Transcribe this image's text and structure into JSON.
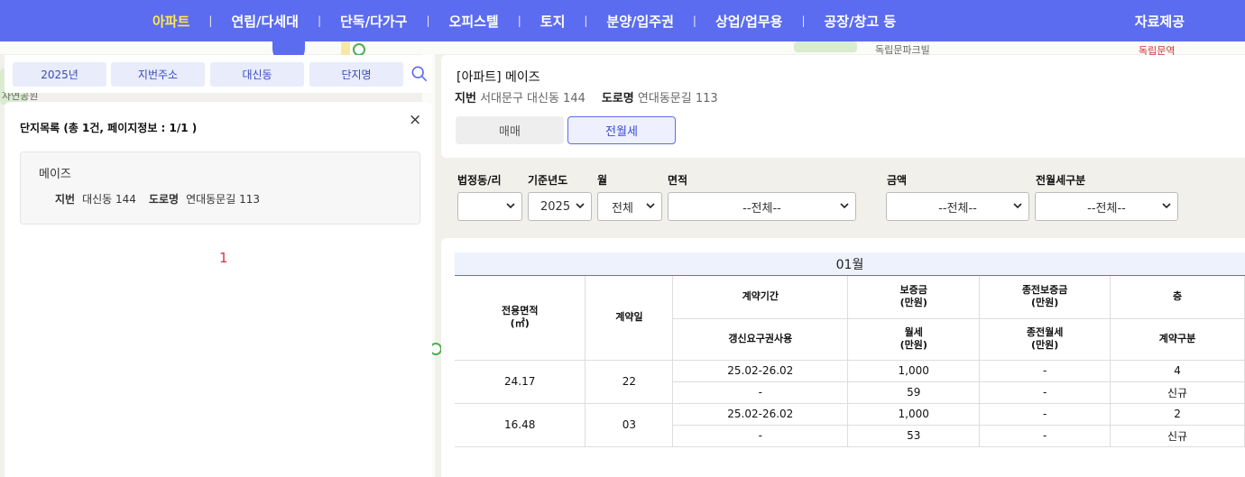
{
  "nav": {
    "items": [
      "아파트",
      "연립/다세대",
      "단독/다가구",
      "오피스텔",
      "토지",
      "분양/입주권",
      "상업/업무용",
      "공장/창고 등"
    ],
    "separator": "|",
    "data_link": "자료제공"
  },
  "map": {
    "labels": [
      "자연공원",
      "독립문파크빌",
      "독립문역"
    ]
  },
  "search": {
    "year": "2025년",
    "address_type": "지번주소",
    "dong": "대신동",
    "complex_name": "단지명"
  },
  "complex_list": {
    "title": "단지목록 (총 1건, 페이지정보 : 1/1 )",
    "close": "×",
    "items": [
      {
        "name": "메이즈",
        "jibun_label": "지번",
        "jibun": "대신동 144",
        "road_label": "도로명",
        "road": "연대동문길 113"
      }
    ],
    "page": "1"
  },
  "detail": {
    "title": "[아파트] 메이즈",
    "jibun_label": "지번",
    "jibun": "서대문구 대신동 144",
    "road_label": "도로명",
    "road": "연대동문길 113",
    "tab_sale": "매매",
    "tab_rent": "전월세",
    "active_tab": "전월세"
  },
  "filters": {
    "dong": {
      "label": "법정동/리",
      "value": ""
    },
    "year": {
      "label": "기준년도",
      "value": "2025"
    },
    "month": {
      "label": "월",
      "value": "전체"
    },
    "area": {
      "label": "면적",
      "value": "--전체--"
    },
    "amount": {
      "label": "금액",
      "value": "--전체--"
    },
    "rent_type": {
      "label": "전월세구분",
      "value": "--전체--"
    }
  },
  "table": {
    "month": "01월",
    "headers": {
      "area": "전용면적\n(㎡)",
      "day": "계약일",
      "period": "계약기간",
      "deposit": "보증금\n(만원)",
      "prev_deposit": "종전보증금\n(만원)",
      "floor": "층",
      "renewal": "갱신요구권사용",
      "monthly": "월세\n(만원)",
      "prev_monthly": "종전월세\n(만원)",
      "contract_type": "계약구분"
    },
    "rows": [
      {
        "area": "24.17",
        "day": "22",
        "period": "25.02-26.02",
        "deposit": "1,000",
        "prev_deposit": "-",
        "floor": "4",
        "renewal": "-",
        "monthly": "59",
        "prev_monthly": "-",
        "contract_type": "신규"
      },
      {
        "area": "16.48",
        "day": "03",
        "period": "25.02-26.02",
        "deposit": "1,000",
        "prev_deposit": "-",
        "floor": "2",
        "renewal": "-",
        "monthly": "53",
        "prev_monthly": "-",
        "contract_type": "신규"
      }
    ]
  },
  "colors": {
    "nav_bg": "#5b6cf0",
    "nav_active": "#ffe84d",
    "accent": "#3b4ad6",
    "page_number": "#d93333"
  }
}
